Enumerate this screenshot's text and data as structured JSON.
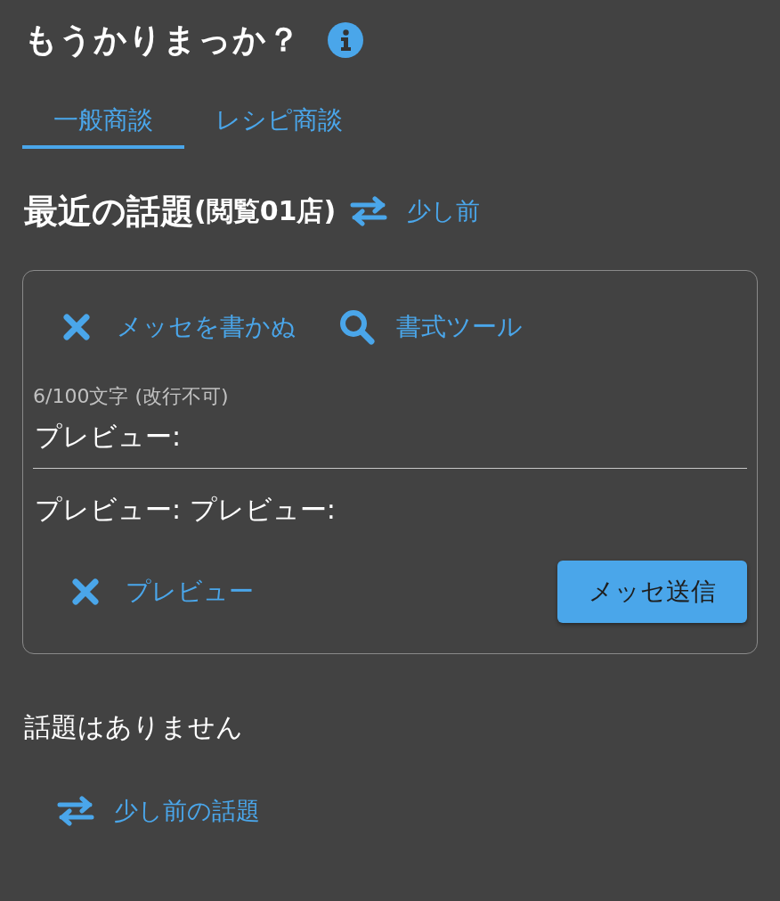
{
  "app": {
    "title": "もうかりまっか？"
  },
  "tabs": [
    {
      "label": "一般商談",
      "selected": true
    },
    {
      "label": "レシピ商談",
      "selected": false
    }
  ],
  "topics_header": {
    "title": "最近の話題",
    "count": "(閲覧01店)",
    "link": {
      "kind": "swap",
      "label": "少し前"
    }
  },
  "composer": {
    "toolbar": [
      {
        "kind": "close",
        "label": "メッセを書かぬ"
      },
      {
        "kind": "search",
        "label": "書式ツール"
      }
    ],
    "counter": "6/100文字 (改行不可)",
    "input": {
      "value": "プレビュー:"
    },
    "preview": "プレビュー: プレビュー:",
    "dismiss": {
      "kind": "close",
      "label": "プレビュー"
    },
    "submit": "メッセ送信"
  },
  "empty_message": "話題はありません",
  "older_link": {
    "kind": "swap",
    "label": "少し前の話題"
  }
}
